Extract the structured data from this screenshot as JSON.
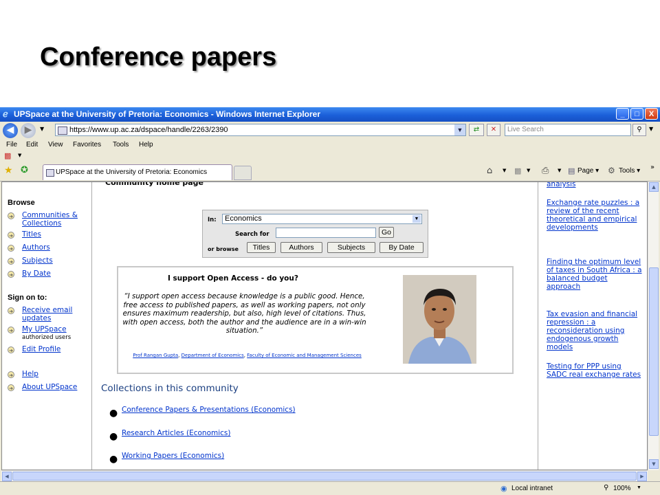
{
  "slide": {
    "title": "Conference papers"
  },
  "window": {
    "title": "UPSpace at the University of Pretoria: Economics - Windows Internet Explorer",
    "controls": {
      "minimize": "_",
      "maximize": "□",
      "close": "X"
    }
  },
  "address": {
    "url": "https://www.up.ac.za/dspace/handle/2263/2390",
    "search_placeholder": "Live Search"
  },
  "menu": [
    "File",
    "Edit",
    "View",
    "Favorites",
    "Tools",
    "Help"
  ],
  "tab": {
    "label": "UPSpace at the University of Pretoria: Economics"
  },
  "commands": {
    "page": "Page",
    "tools": "Tools"
  },
  "page": {
    "cut_heading": "Community home page"
  },
  "sidebar": {
    "browse_heading": "Browse",
    "browse_items": [
      {
        "label": "Communities & Collections"
      },
      {
        "label": "Titles"
      },
      {
        "label": "Authors"
      },
      {
        "label": "Subjects"
      },
      {
        "label": "By Date"
      }
    ],
    "signon_heading": "Sign on to:",
    "signon_items": [
      {
        "label": "Receive email updates"
      },
      {
        "label": "My UPSpace",
        "sub": "authorized users"
      },
      {
        "label": "Edit Profile"
      }
    ],
    "help_items": [
      {
        "label": "Help"
      },
      {
        "label": "About UPSpace"
      }
    ]
  },
  "search": {
    "in_label": "In:",
    "scope_value": "Economics",
    "search_for_label": "Search for",
    "go_label": "Go",
    "or_browse_label": "or browse",
    "browse_buttons": [
      "Titles",
      "Authors",
      "Subjects",
      "By Date"
    ]
  },
  "open_access": {
    "title": "I support Open Access - do you?",
    "quote": "“I support open access because knowledge is a public good. Hence, free access to published papers, as well as working papers, not only ensures maximum readership, but also, high level of citations. Thus, with open access, both the author and the audience are in a win-win situation.”",
    "credit_name": "Prof Rangan Gupta",
    "credit_dept": "Department of Economics",
    "credit_faculty": "Faculty of Economic and Management Sciences"
  },
  "collections": {
    "heading": "Collections in this community",
    "items": [
      {
        "label": "Conference Papers & Presentations (Economics)"
      },
      {
        "label": "Research Articles (Economics)"
      },
      {
        "label": "Working Papers (Economics)"
      }
    ]
  },
  "recent": [
    {
      "label": "analysis"
    },
    {
      "label": "Exchange rate puzzles : a review of the recent theoretical and empirical developments"
    },
    {
      "label": "Finding the optimum level of taxes in South Africa : a balanced budget approach"
    },
    {
      "label": "Tax evasion and financial repression : a reconsideration using endogenous growth models"
    },
    {
      "label": "Testing for PPP using SADC real exchange rates"
    }
  ],
  "status": {
    "zone": "Local intranet",
    "zoom": "100%"
  },
  "icons": [
    "ie-logo-icon",
    "back-icon",
    "forward-icon",
    "refresh-icon",
    "stop-icon",
    "search-icon",
    "favorites-star-icon",
    "add-favorite-icon",
    "home-icon",
    "feeds-icon",
    "print-icon",
    "page-icon",
    "tools-gear-icon",
    "globe-icon",
    "lock-icon",
    "circle-arrow-icon"
  ]
}
